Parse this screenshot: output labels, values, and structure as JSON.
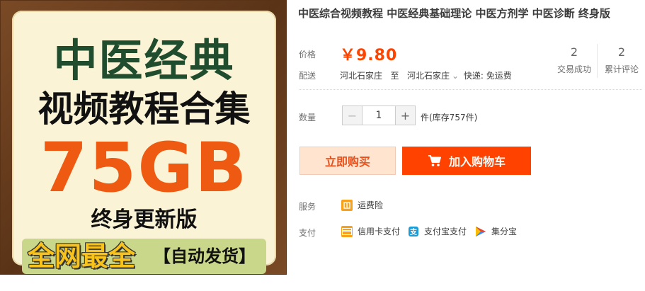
{
  "product_image": {
    "title_line_1": "中医经典",
    "title_line_2": "视频教程合集",
    "size": "75GB",
    "lifetime": "终身更新版",
    "banner_main": "全网最全",
    "banner_tag": "【自动发货】"
  },
  "product": {
    "title": "中医综合视频教程 中医经典基础理论 中医方剂学 中医诊断 终身版"
  },
  "price": {
    "label": "价格",
    "value": "￥9.80"
  },
  "shipping": {
    "label": "配送",
    "from": "河北石家庄",
    "to_word": "至",
    "to": "河北石家庄",
    "method": "快递: 免运费"
  },
  "stats": {
    "transactions_count": "2",
    "transactions_label": "交易成功",
    "reviews_count": "2",
    "reviews_label": "累计评论"
  },
  "quantity": {
    "label": "数量",
    "minus": "−",
    "value": "1",
    "plus": "+",
    "stock": "件(库存757件)"
  },
  "actions": {
    "buy_now": "立即购买",
    "add_to_cart": "加入购物车"
  },
  "service": {
    "label": "服务",
    "items": [
      {
        "icon": "freight-insurance-icon",
        "label": "运费险"
      }
    ]
  },
  "payment": {
    "label": "支付",
    "items": [
      {
        "icon": "credit-card-icon",
        "label": "信用卡支付"
      },
      {
        "icon": "alipay-icon",
        "label": "支付宝支付"
      },
      {
        "icon": "jifenbao-icon",
        "label": "集分宝"
      }
    ]
  },
  "colors": {
    "accent": "#ff4400",
    "buy_now_bg": "#ffe4d0",
    "cart_bg": "#ff4200"
  }
}
